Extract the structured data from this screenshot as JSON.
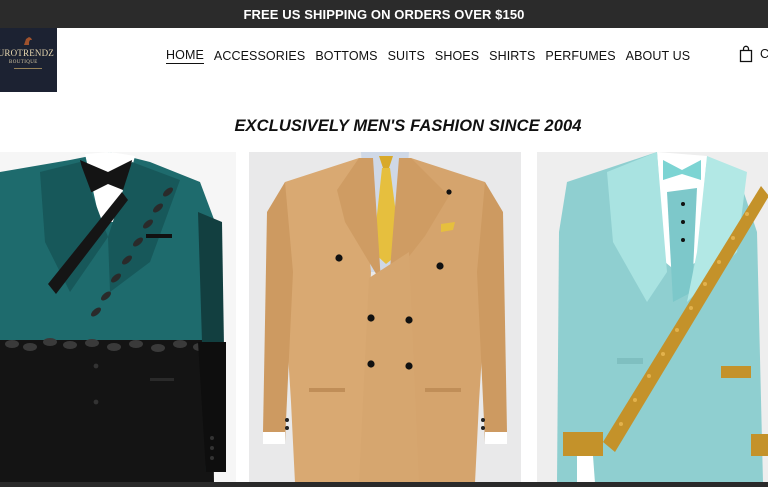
{
  "announcement": {
    "text": "FREE US SHIPPING ON ORDERS OVER $150"
  },
  "logo": {
    "name": "EUROTRENDZ",
    "subtitle": "BOUTIQUE",
    "icon": "horse-head-icon"
  },
  "nav": {
    "items": [
      {
        "label": "HOME",
        "active": true
      },
      {
        "label": "ACCESSORIES"
      },
      {
        "label": "BOTTOMS"
      },
      {
        "label": "SUITS"
      },
      {
        "label": "SHOES"
      },
      {
        "label": "SHIRTS"
      },
      {
        "label": "PERFUMES"
      },
      {
        "label": "ABOUT US"
      }
    ]
  },
  "cart": {
    "label": "CART",
    "icon": "shopping-bag-icon"
  },
  "hero": {
    "tagline": "EXCLUSIVELY MEN'S FASHION SINCE 2004"
  },
  "products": [
    {
      "image": "teal-black-tuxedo-with-black-embroidery",
      "colors": [
        "#1d6a6b",
        "#141414"
      ]
    },
    {
      "image": "tan-double-breasted-suit-yellow-tie",
      "colors": [
        "#d9a972",
        "#e6bf3e"
      ]
    },
    {
      "image": "light-blue-tuxedo-with-gold-beaded-sash",
      "colors": [
        "#8fcfd0",
        "#c4922a"
      ]
    }
  ]
}
